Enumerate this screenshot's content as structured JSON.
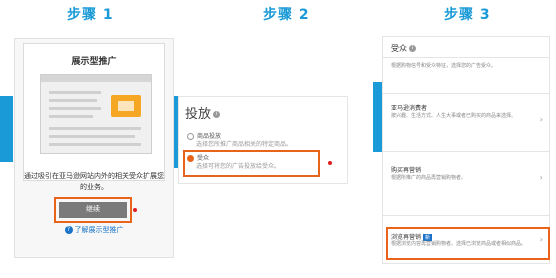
{
  "steps": [
    {
      "title": "步骤 1"
    },
    {
      "title": "步骤 2"
    },
    {
      "title": "步骤 3"
    }
  ],
  "panel1": {
    "card_title": "展示型推广",
    "description": "通过吸引在亚马逊网站内外的相关受众扩展您的业务。",
    "continue_label": "继续",
    "learn_more_label": "了解展示型推广"
  },
  "panel2": {
    "title": "投放",
    "option1_label": "商品投放",
    "option1_sub": "选择您所推广商品相关的特定商品。",
    "option2_label": "受众",
    "option2_sub": "选择可将您的广告投放给受众。"
  },
  "panel3": {
    "header": "受众",
    "intro": "根据购物信号和受众特征，选择您的广告受众。",
    "section1_title": "亚马逊消费者",
    "section1_text": "按兴趣、生活方式、人生大事或者已购买的商品来选择。",
    "section2_title": "购买再营销",
    "section2_text": "根据所推广的商品再营销购物者。",
    "section3_title": "浏览再营销",
    "section3_badge": "新",
    "section3_text": "根据浏览内容再营销购物者。选择已浏览商品或者相似商品。"
  },
  "colors": {
    "accent_blue": "#1a9ad6",
    "highlight_orange": "#e8641b",
    "marker_red": "#e02020"
  }
}
